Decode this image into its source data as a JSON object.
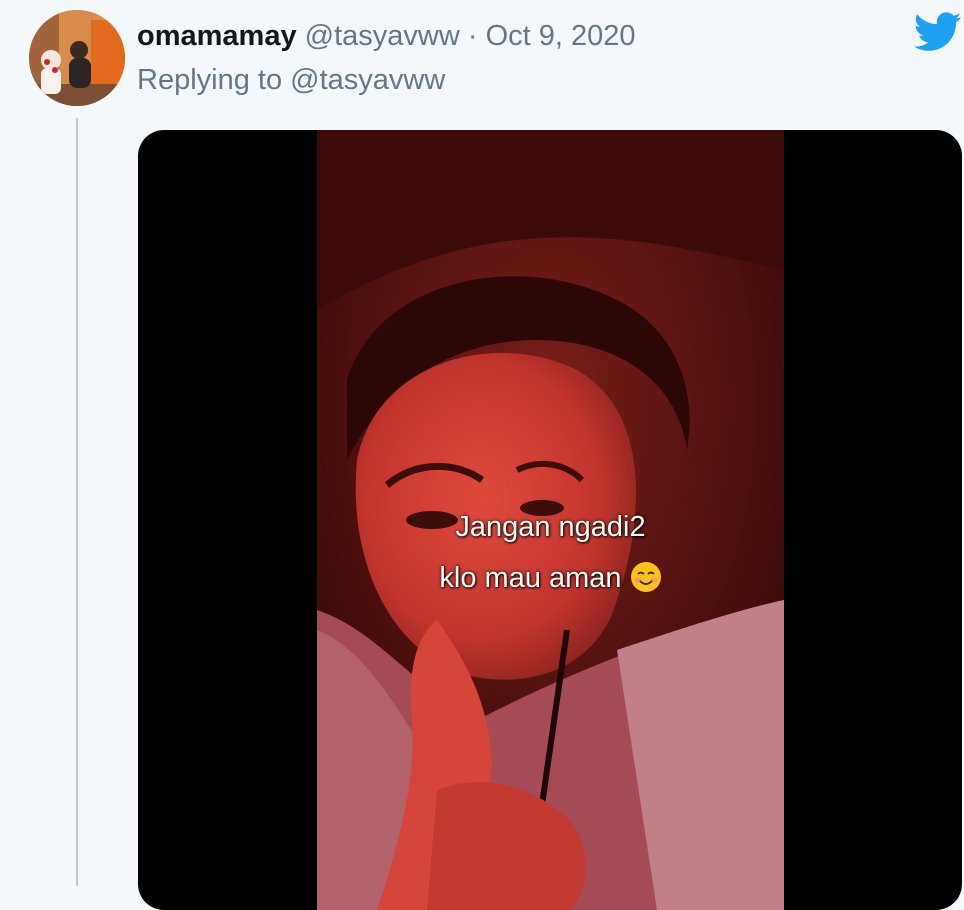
{
  "tweet": {
    "display_name": "omamamay",
    "handle": "@tasyavww",
    "separator": "·",
    "date": "Oct 9, 2020",
    "replying_prefix": "Replying to ",
    "replying_to": "@tasyavww"
  },
  "media": {
    "caption_line1": "Jangan ngadi2",
    "caption_line2": "klo mau aman",
    "emoji": "smiling-face-emoji"
  },
  "icons": {
    "logo": "twitter-bird-icon"
  },
  "colors": {
    "twitter_blue": "#1da1f2",
    "text_primary": "#14171a",
    "text_secondary": "#657786",
    "background": "#f5f8fa",
    "thread_line": "#b9cbd8"
  }
}
